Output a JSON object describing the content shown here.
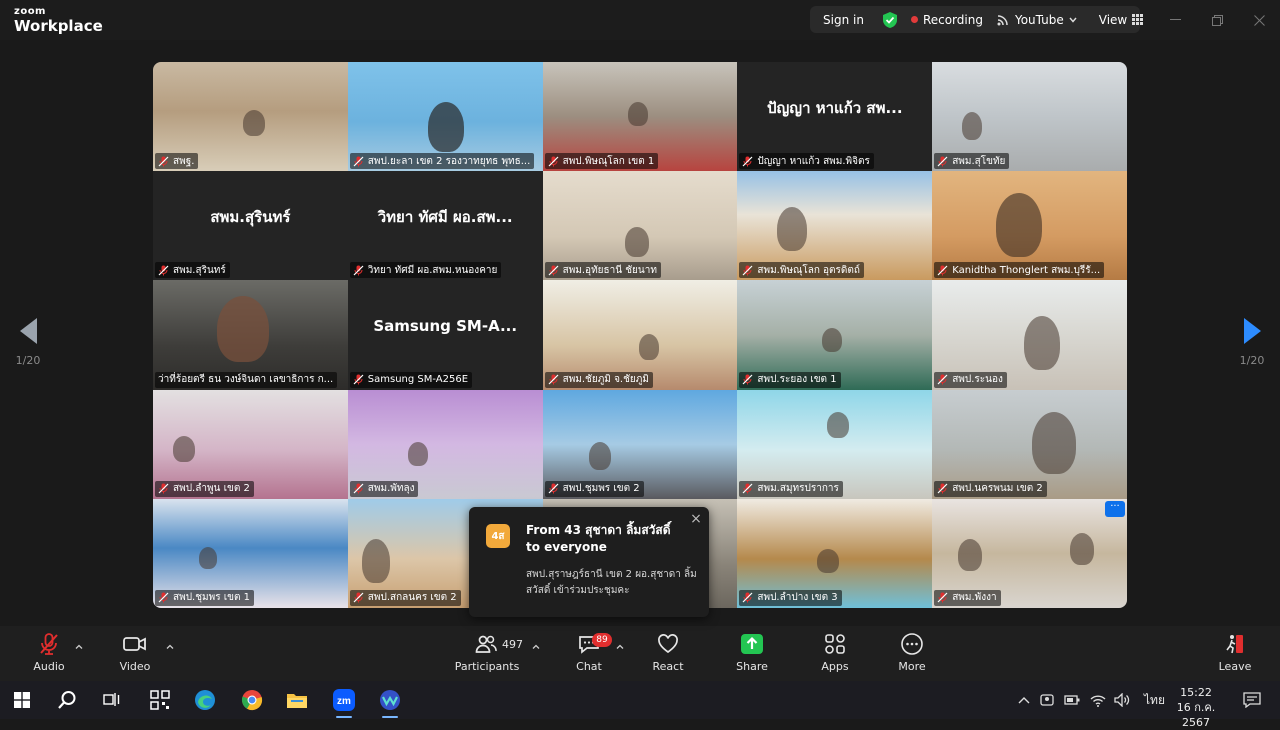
{
  "app": {
    "brand_small": "zoom",
    "brand_large": "Workplace"
  },
  "titlebar": {
    "sign_in": "Sign in",
    "recording": "Recording",
    "youtube": "YouTube",
    "view": "View"
  },
  "nav": {
    "left_page": "1/20",
    "right_page": "1/20"
  },
  "tiles": [
    {
      "name": "สพฐ.",
      "center": ""
    },
    {
      "name": "สพป.ยะลา เขต 2 รองวาทยุทธ พุทธ...",
      "center": ""
    },
    {
      "name": "สพป.พิษณุโลก เขต 1",
      "center": ""
    },
    {
      "name": "ปัญญา หาแก้ว สพม.พิจิตร",
      "center": "ปัญญา หาแก้ว สพ..."
    },
    {
      "name": "สพม.สุโขทัย",
      "center": ""
    },
    {
      "name": "สพม.สุรินทร์",
      "center": "สพม.สุรินทร์"
    },
    {
      "name": "วิทยา ทัศมี ผอ.สพม.หนองคาย",
      "center": "วิทยา ทัศมี ผอ.สพ..."
    },
    {
      "name": "สพม.อุทัยธานี ชัยนาท",
      "center": ""
    },
    {
      "name": "สพม.พิษณุโลก อุตรดิตถ์",
      "center": ""
    },
    {
      "name": "Kanidtha Thonglert สพม.บุรีรั...",
      "center": ""
    },
    {
      "name": "ว่าที่ร้อยตรี ธน วงษ์จินดา เลขาธิการ ก...",
      "center": ""
    },
    {
      "name": "Samsung SM-A256E",
      "center": "Samsung  SM-A..."
    },
    {
      "name": "สพม.ชัยภูมิ จ.ชัยภูมิ",
      "center": ""
    },
    {
      "name": "สพป.ระยอง เขต 1",
      "center": ""
    },
    {
      "name": "สพป.ระนอง",
      "center": ""
    },
    {
      "name": "สพป.ลำพูน เขต 2",
      "center": ""
    },
    {
      "name": "สพม.พัทลุง",
      "center": ""
    },
    {
      "name": "สพป.ชุมพร เขต 2",
      "center": ""
    },
    {
      "name": "สพม.สมุทรปราการ",
      "center": ""
    },
    {
      "name": "สพป.นครพนม เขต 2",
      "center": ""
    },
    {
      "name": "สพป.ชุมพร เขต 1",
      "center": ""
    },
    {
      "name": "สพป.สกลนคร เขต 2",
      "center": ""
    },
    {
      "name": "",
      "center": ""
    },
    {
      "name": "สพป.ลำปาง เขต 3",
      "center": ""
    },
    {
      "name": "สพม.พังงา",
      "center": ""
    }
  ],
  "tile_more": "···",
  "chat_toast": {
    "avatar": "4ส",
    "title": "From 43 สุชาดา  ลิ้มสวัสดิ์ to everyone",
    "message": "สพป.สุราษฎร์ธานี เขต 2  ผอ.สุชาดา ลิ้มสวัสดิ์ เข้าร่วมประชุมคะ",
    "close": "×"
  },
  "toolbar": {
    "audio": "Audio",
    "video": "Video",
    "participants": "Participants",
    "participants_count": "497",
    "chat": "Chat",
    "chat_badge": "89",
    "react": "React",
    "share": "Share",
    "apps": "Apps",
    "more": "More",
    "leave": "Leave"
  },
  "taskbar": {
    "language": "ไทย",
    "time": "15:22",
    "date": "16 ก.ค. 2567",
    "zoom_app": "zm"
  },
  "colors": {
    "accent": "#2d8cff",
    "share_green": "#23c552",
    "mute_red": "#e02e2e",
    "active_speaker": "#2fcf6e"
  }
}
